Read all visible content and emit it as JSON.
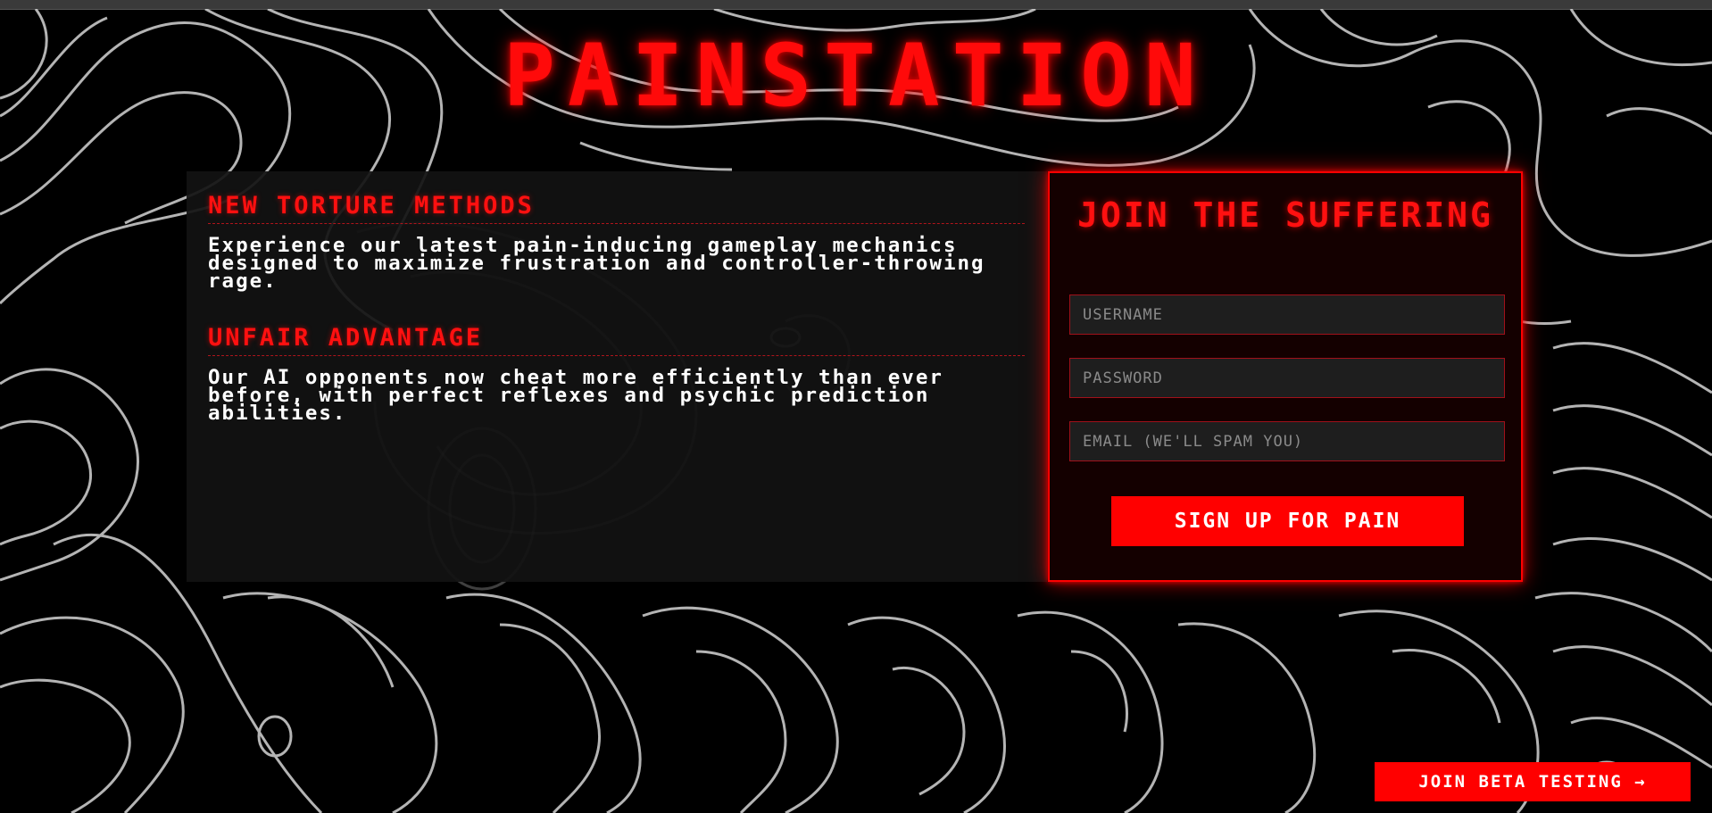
{
  "site_title": "PAINSTATION",
  "features": [
    {
      "title": "NEW TORTURE METHODS",
      "text": "Experience our latest pain-inducing gameplay mechanics designed to maximize frustration and controller-throwing rage."
    },
    {
      "title": "UNFAIR ADVANTAGE",
      "text": "Our AI opponents now cheat more efficiently than ever before, with perfect reflexes and psychic prediction abilities."
    }
  ],
  "signup": {
    "heading": "JOIN THE SUFFERING",
    "username_placeholder": "USERNAME",
    "password_placeholder": "PASSWORD",
    "email_placeholder": "EMAIL (WE'LL SPAM YOU)",
    "submit_label": "SIGN UP FOR PAIN"
  },
  "beta_button_label": "JOIN BETA TESTING →",
  "colors": {
    "accent": "#ff0000",
    "background": "#000000",
    "panel": "#121212",
    "text": "#ffffff",
    "contour_lines": "#d8d8d8"
  },
  "background_pattern": "topographic-contour-lines"
}
